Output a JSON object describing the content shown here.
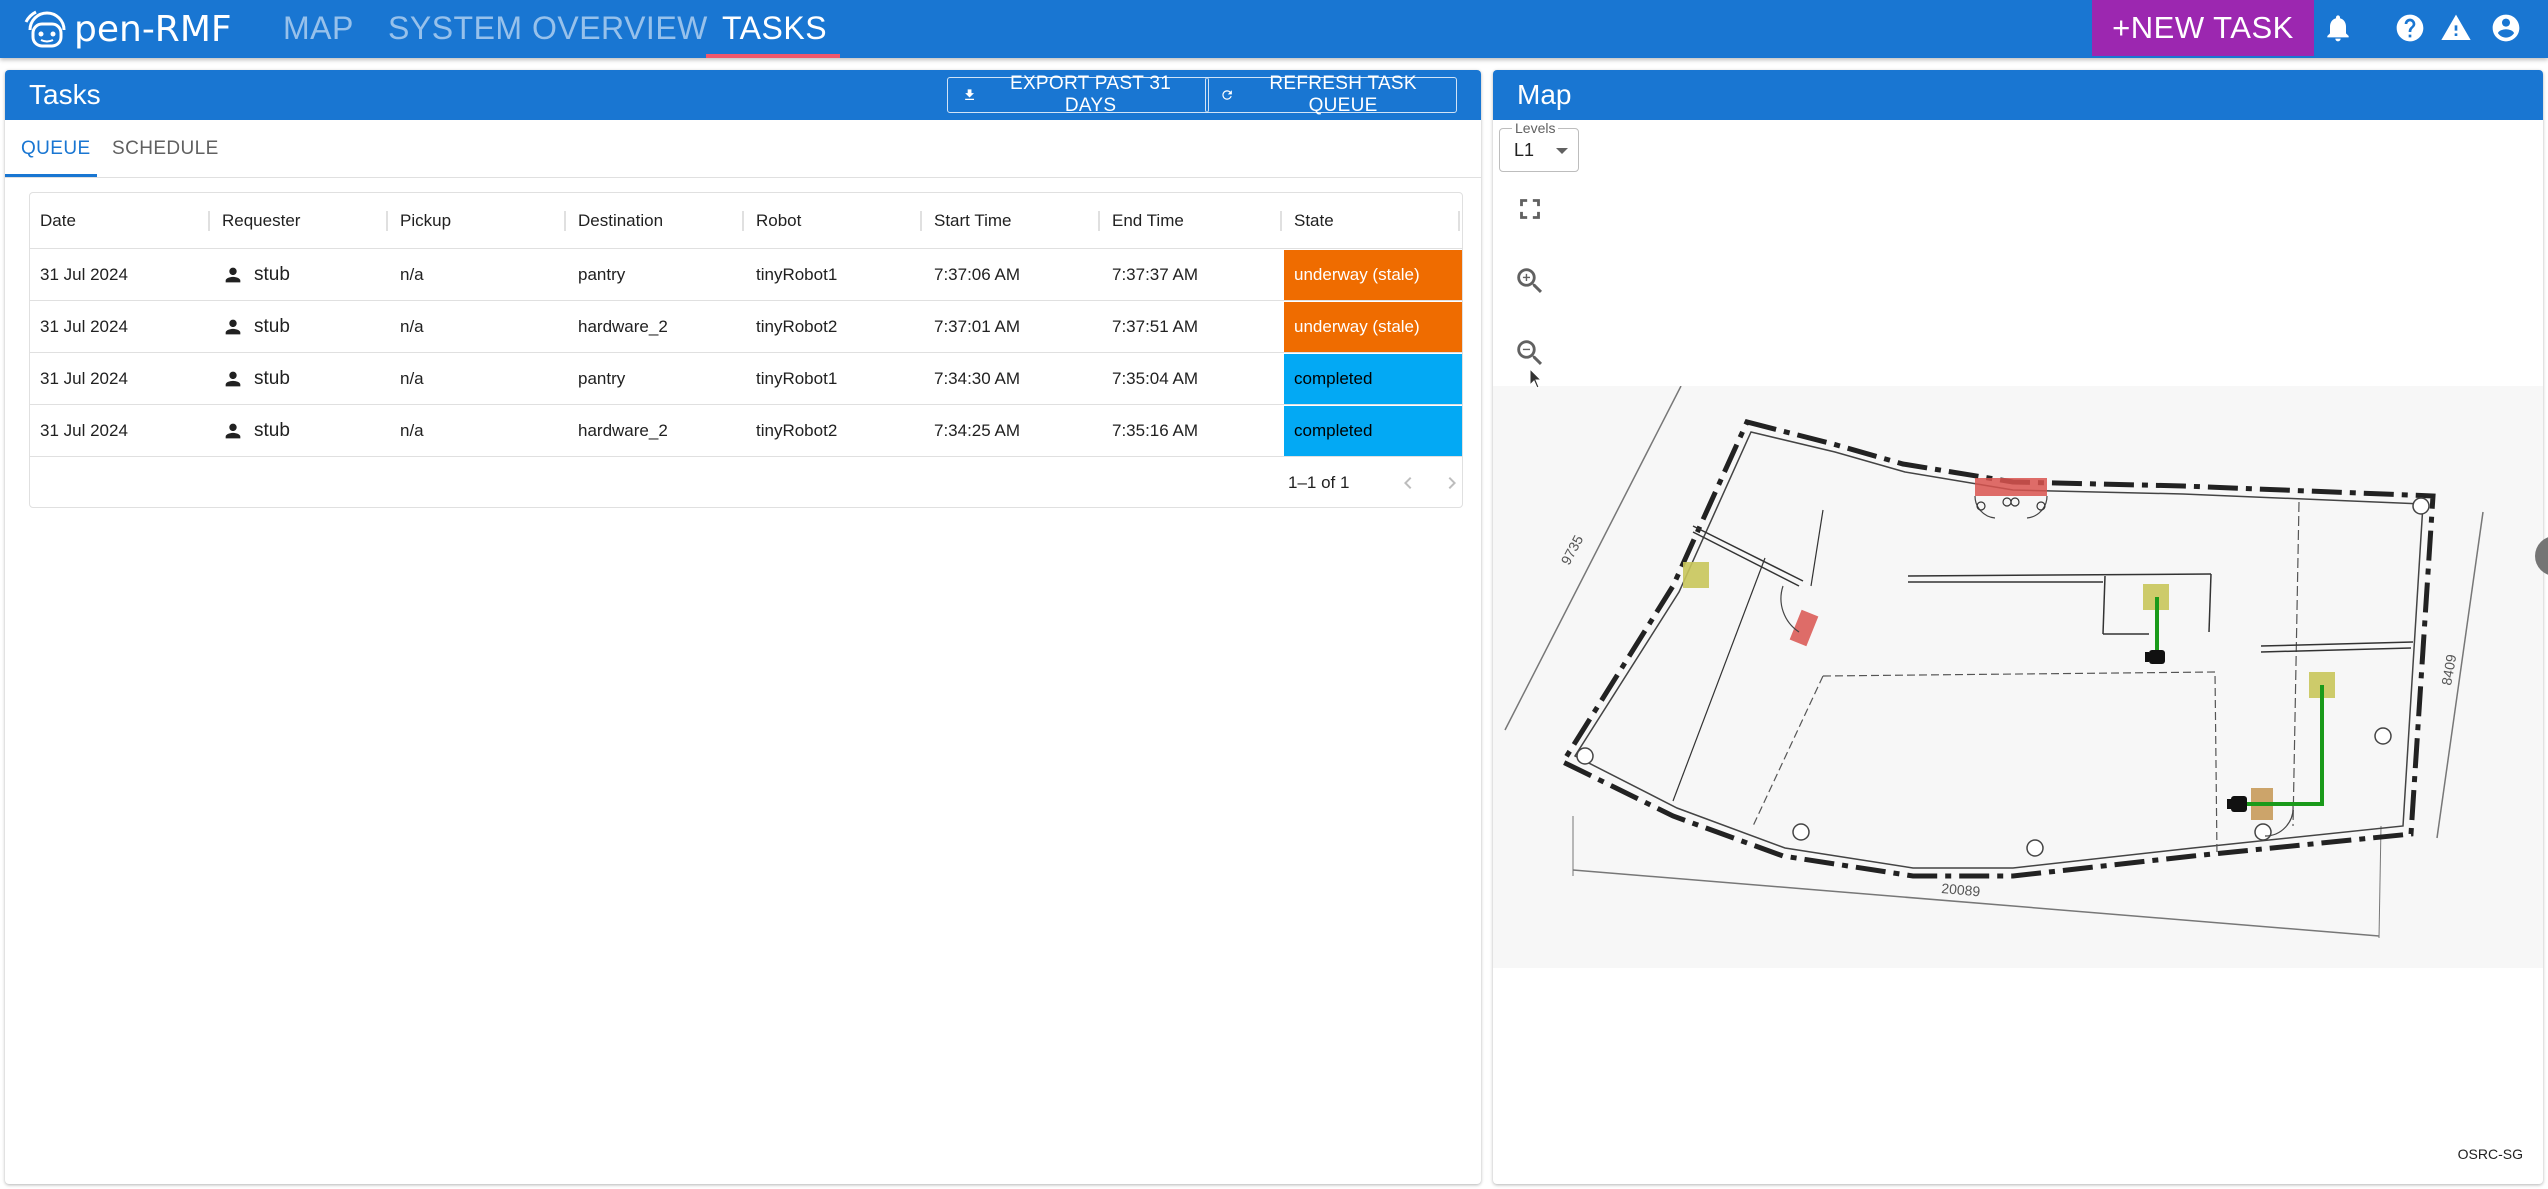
{
  "app": {
    "logo_text": "pen-RMF",
    "nav": [
      {
        "label": "MAP"
      },
      {
        "label": "SYSTEM OVERVIEW"
      },
      {
        "label": "TASKS"
      }
    ],
    "active_nav": "TASKS",
    "new_task_label": "+NEW TASK",
    "icons": [
      "bell-icon",
      "help-icon",
      "warning-icon",
      "account-circle-icon"
    ],
    "colors": {
      "primary": "#1976d2",
      "accent": "#9c27b0",
      "nav_indicator": "#f0576b"
    }
  },
  "tasks_panel": {
    "title": "Tasks",
    "export_label": "EXPORT PAST 31 DAYS",
    "refresh_label": "REFRESH TASK QUEUE",
    "tabs": [
      {
        "label": "QUEUE"
      },
      {
        "label": "SCHEDULE"
      }
    ],
    "active_tab": "QUEUE",
    "columns": [
      "Date",
      "Requester",
      "Pickup",
      "Destination",
      "Robot",
      "Start Time",
      "End Time",
      "State"
    ],
    "rows": [
      {
        "date": "31 Jul 2024",
        "requester": "stub",
        "pickup": "n/a",
        "destination": "pantry",
        "robot": "tinyRobot1",
        "start": "7:37:06 AM",
        "end": "7:37:37 AM",
        "state": "underway (stale)"
      },
      {
        "date": "31 Jul 2024",
        "requester": "stub",
        "pickup": "n/a",
        "destination": "hardware_2",
        "robot": "tinyRobot2",
        "start": "7:37:01 AM",
        "end": "7:37:51 AM",
        "state": "underway (stale)"
      },
      {
        "date": "31 Jul 2024",
        "requester": "stub",
        "pickup": "n/a",
        "destination": "pantry",
        "robot": "tinyRobot1",
        "start": "7:34:30 AM",
        "end": "7:35:04 AM",
        "state": "completed"
      },
      {
        "date": "31 Jul 2024",
        "requester": "stub",
        "pickup": "n/a",
        "destination": "hardware_2",
        "robot": "tinyRobot2",
        "start": "7:34:25 AM",
        "end": "7:35:16 AM",
        "state": "completed"
      }
    ],
    "state_colors": {
      "underway (stale)": "#ef6c00",
      "completed": "#03a9f4"
    },
    "pagination": "1–1 of 1"
  },
  "map_panel": {
    "title": "Map",
    "levels_label": "Levels",
    "level_value": "L1",
    "controls": [
      "fullscreen-icon",
      "zoom-in-icon",
      "zoom-out-icon",
      "layers-icon"
    ],
    "dimension_labels": {
      "left": "9735",
      "right": "8409",
      "bottom": "20089"
    },
    "attribution": "OSRC-SG"
  }
}
